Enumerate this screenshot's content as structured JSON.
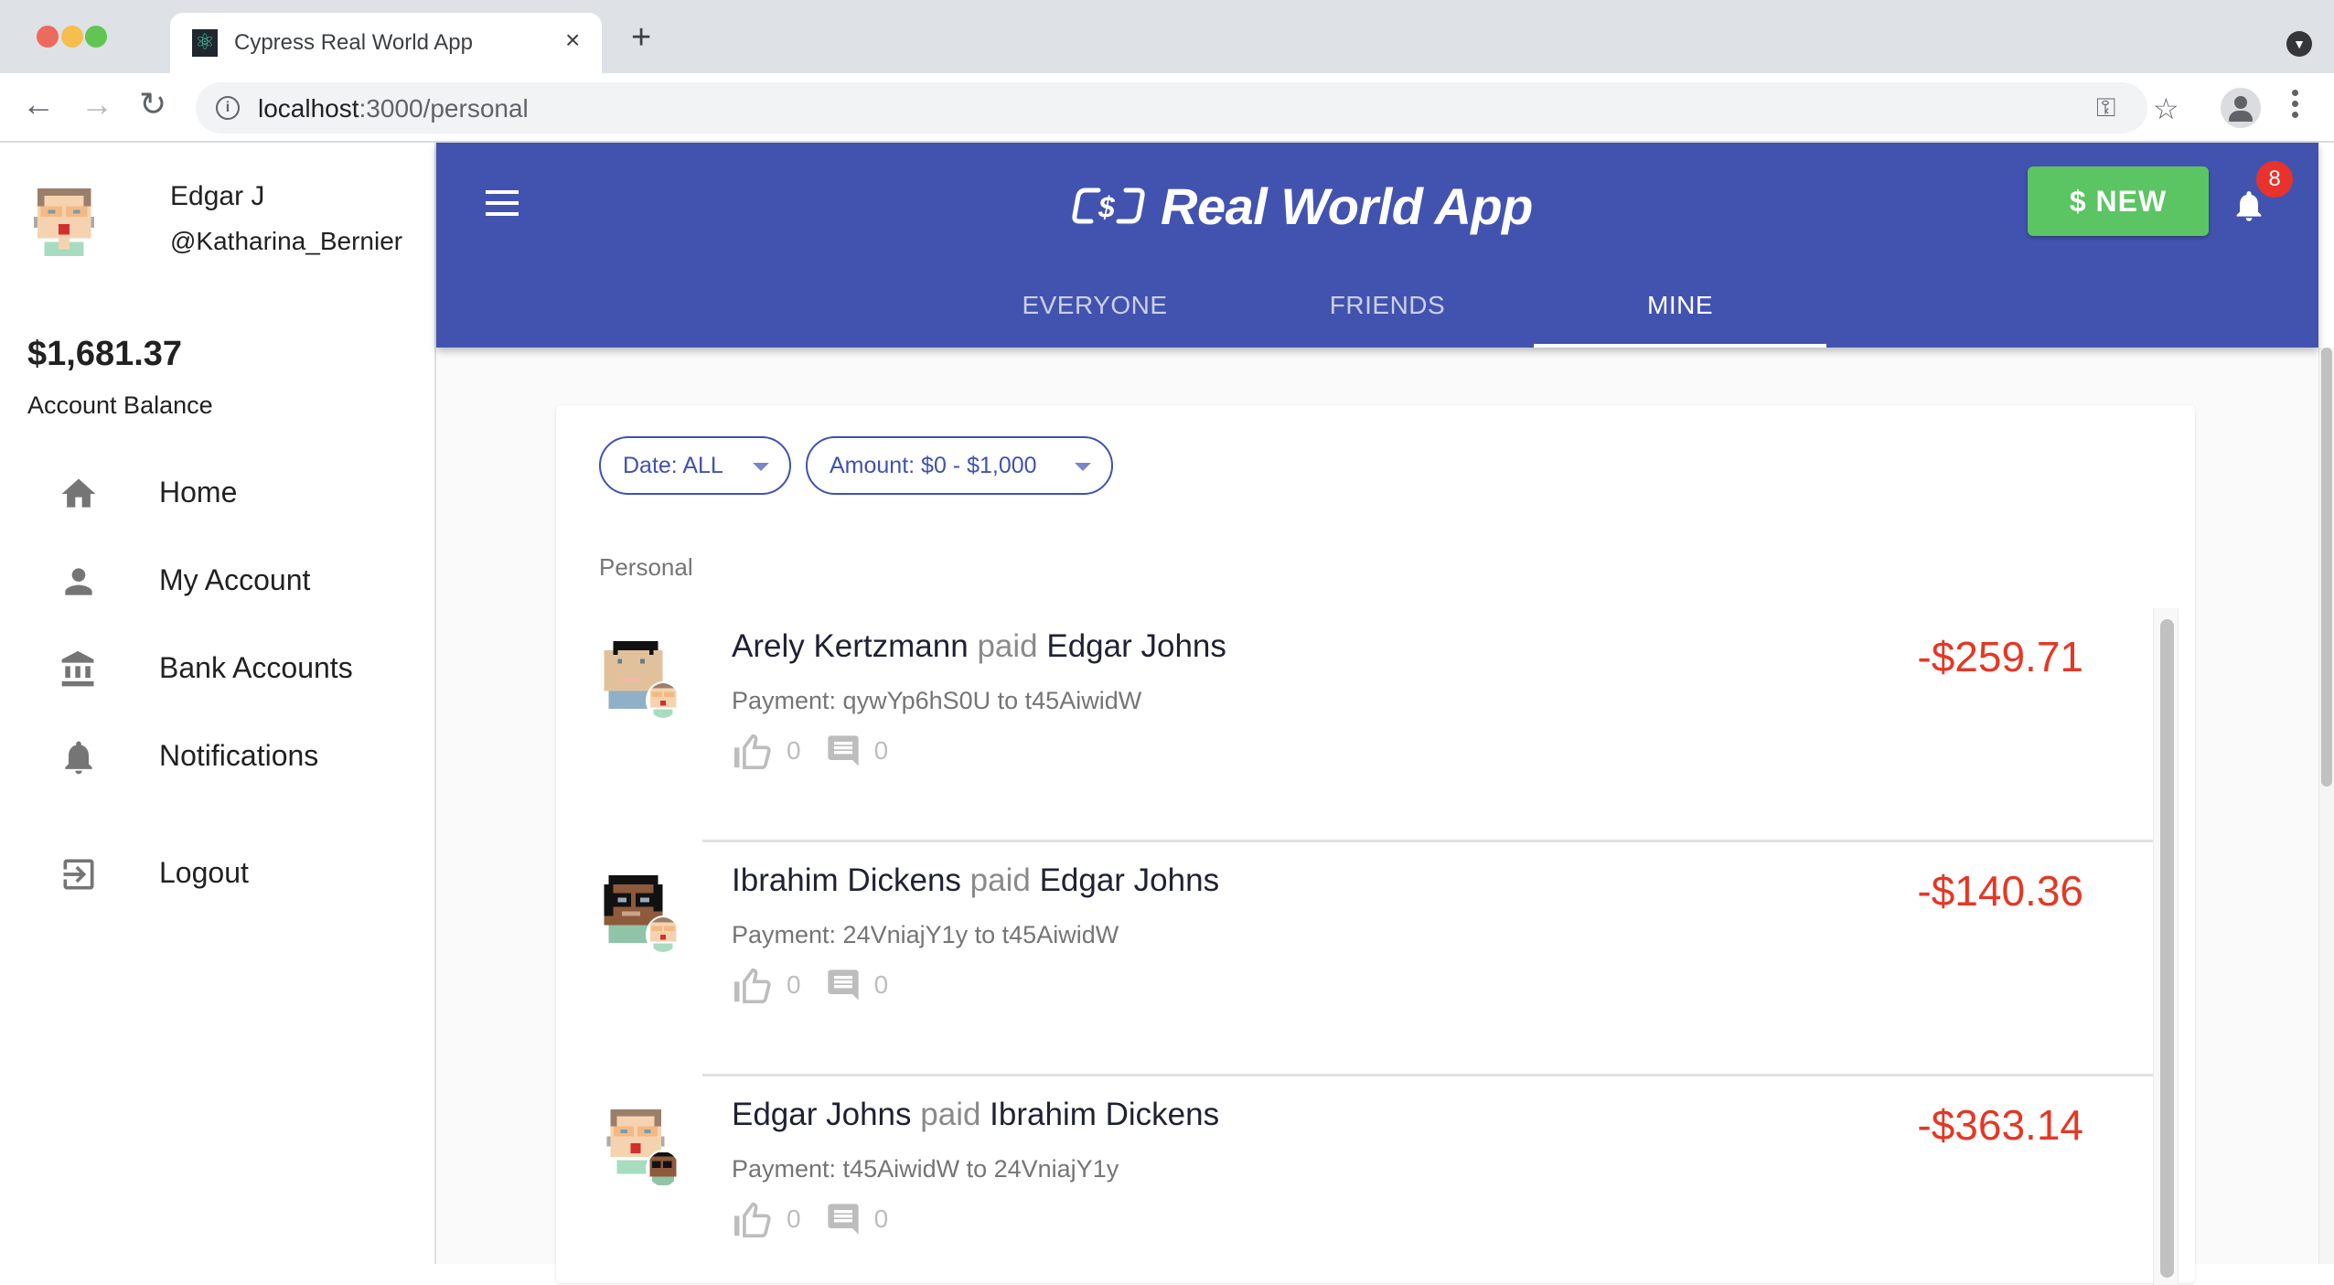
{
  "browser": {
    "tab_title": "Cypress Real World App",
    "tab_close": "×",
    "new_tab": "+",
    "url_host": "localhost",
    "url_path": ":3000/personal"
  },
  "sidebar": {
    "user_name": "Edgar J",
    "user_handle": "@Katharina_Bernier",
    "balance": "$1,681.37",
    "balance_label": "Account Balance",
    "items": [
      {
        "label": "Home",
        "icon": "home-icon"
      },
      {
        "label": "My Account",
        "icon": "person-icon"
      },
      {
        "label": "Bank Accounts",
        "icon": "bank-icon"
      },
      {
        "label": "Notifications",
        "icon": "bell-icon"
      },
      {
        "label": "Logout",
        "icon": "logout-icon"
      }
    ]
  },
  "appbar": {
    "title": "Real World App",
    "new_button": "$ NEW",
    "notification_count": "8",
    "tabs": [
      {
        "label": "EVERYONE",
        "active": false
      },
      {
        "label": "FRIENDS",
        "active": false
      },
      {
        "label": "MINE",
        "active": true
      }
    ]
  },
  "filters": {
    "date": "Date: ALL",
    "amount": "Amount: $0 - $1,000"
  },
  "section_label": "Personal",
  "transactions": [
    {
      "sender": "Arely Kertzmann",
      "verb": "paid",
      "receiver": "Edgar Johns",
      "detail": "Payment: qywYp6hS0U to t45AiwidW",
      "likes": "0",
      "comments": "0",
      "amount": "-$259.71"
    },
    {
      "sender": "Ibrahim Dickens",
      "verb": "paid",
      "receiver": "Edgar Johns",
      "detail": "Payment: 24VniajY1y to t45AiwidW",
      "likes": "0",
      "comments": "0",
      "amount": "-$140.36"
    },
    {
      "sender": "Edgar Johns",
      "verb": "paid",
      "receiver": "Ibrahim Dickens",
      "detail": "Payment: t45AiwidW to 24VniajY1y",
      "likes": "0",
      "comments": "0",
      "amount": "-$363.14"
    }
  ],
  "colors": {
    "primary": "#4253af",
    "new_button": "#5bc463",
    "badge": "#e8322b",
    "negative_amount": "#e53725"
  }
}
